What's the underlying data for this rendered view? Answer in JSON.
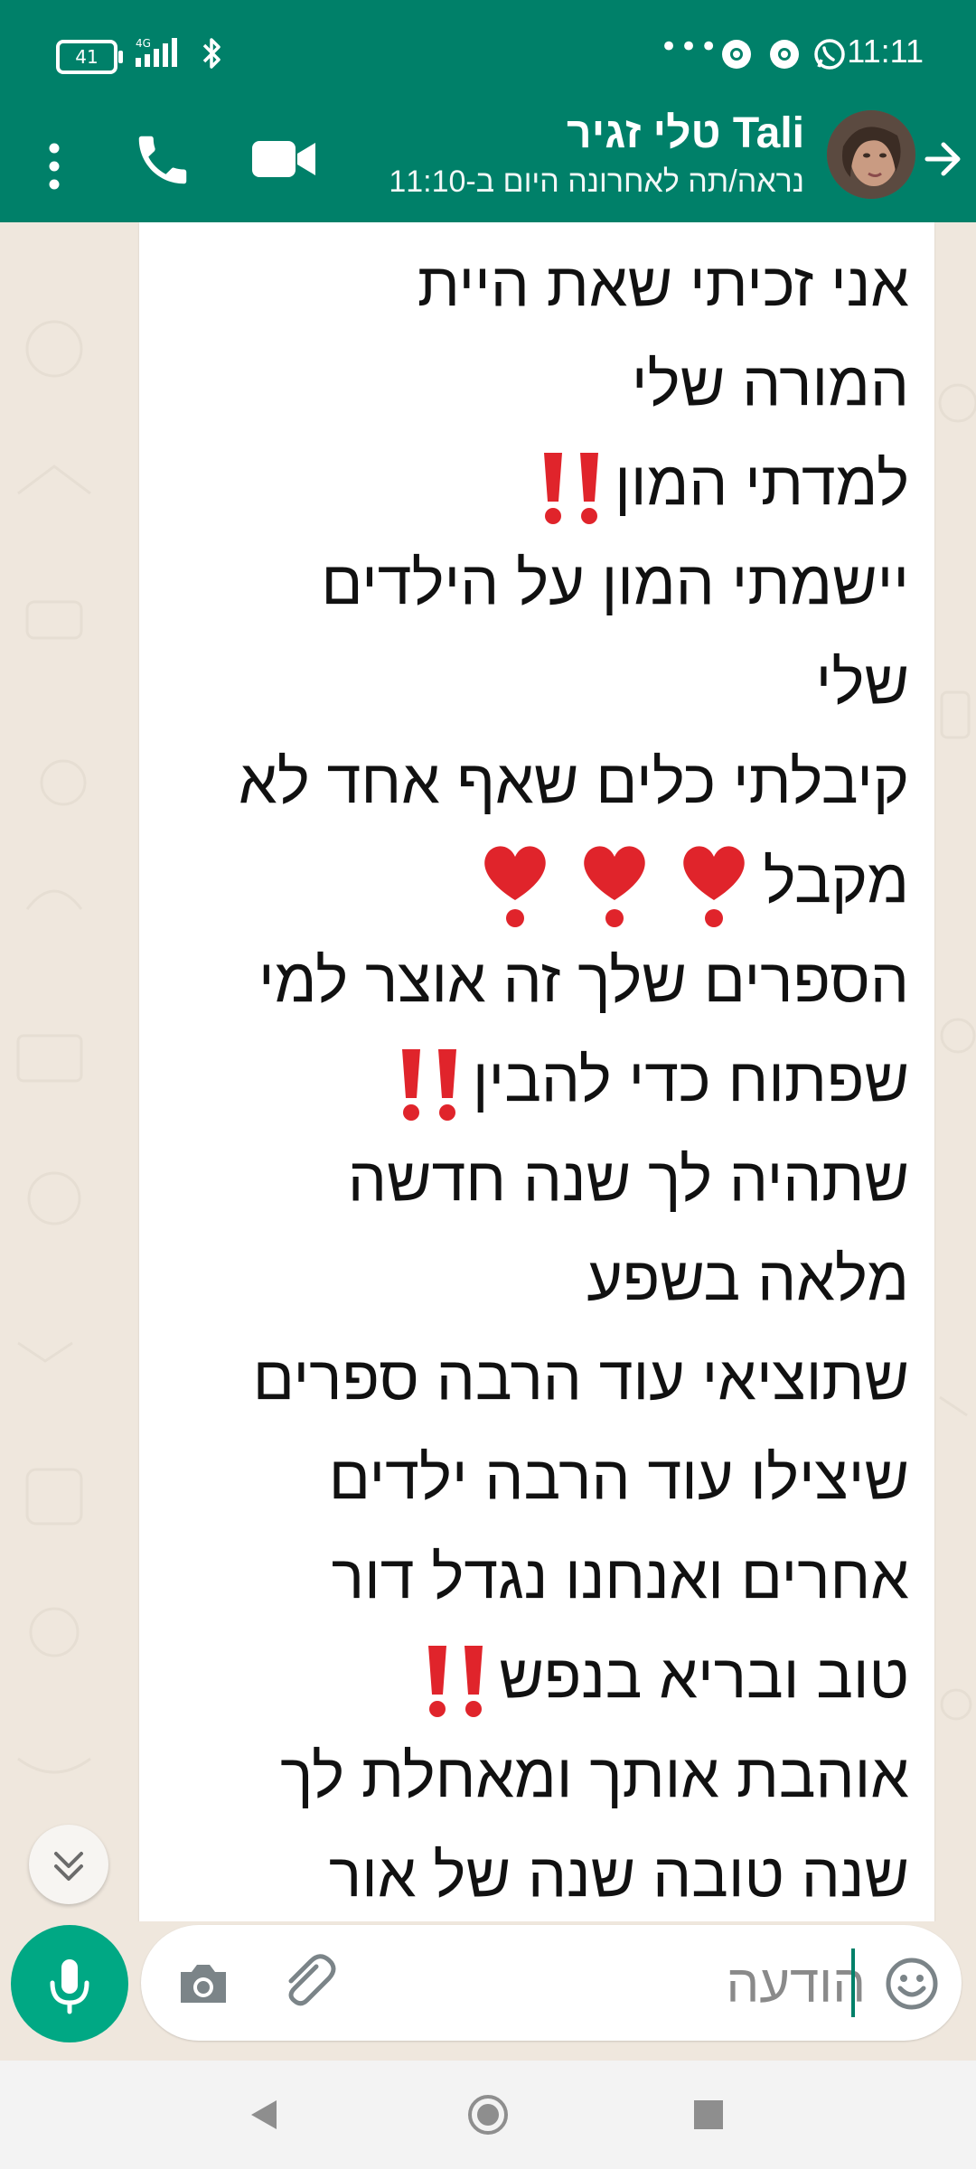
{
  "status_bar": {
    "battery": "41",
    "network": "4G",
    "time": "11:11",
    "overflow": "•••"
  },
  "header": {
    "contact_name": "Tali טלי זגיר",
    "last_seen": "נראה/תה לאחרונה היום ב-11:10"
  },
  "message": {
    "lines": [
      "אני זכיתי שאת היית",
      "המורה שלי",
      "למדתי המון",
      "יישמתי המון על הילדים",
      "שלי",
      "קיבלתי כלים שאף אחד לא",
      "מקבל",
      "הספרים שלך זה אוצר למי",
      "שפתוח כדי להבין",
      "שתהיה לך שנה חדשה",
      "מלאה בשפע",
      "שתוציאי עוד הרבה ספרים",
      "שיצילו עוד הרבה ילדים",
      "אחרים ואנחנו נגדל דור",
      "טוב ובריא בנפש",
      "אוהבת אותך ומאחלת לך",
      "שנה טובה שנה של אור"
    ]
  },
  "composer": {
    "placeholder": "הודעה"
  },
  "colors": {
    "brand_green": "#008069",
    "mic_green": "#00a884",
    "chat_bg": "#efe7dd",
    "emoji_red": "#e0242b"
  },
  "icons": [
    "back-arrow-icon",
    "video-call-icon",
    "phone-icon",
    "more-vert-icon",
    "mic-icon",
    "camera-icon",
    "attach-icon",
    "emoji-icon",
    "chevron-double-down-icon",
    "nav-back-icon",
    "nav-home-icon",
    "nav-recent-icon"
  ]
}
